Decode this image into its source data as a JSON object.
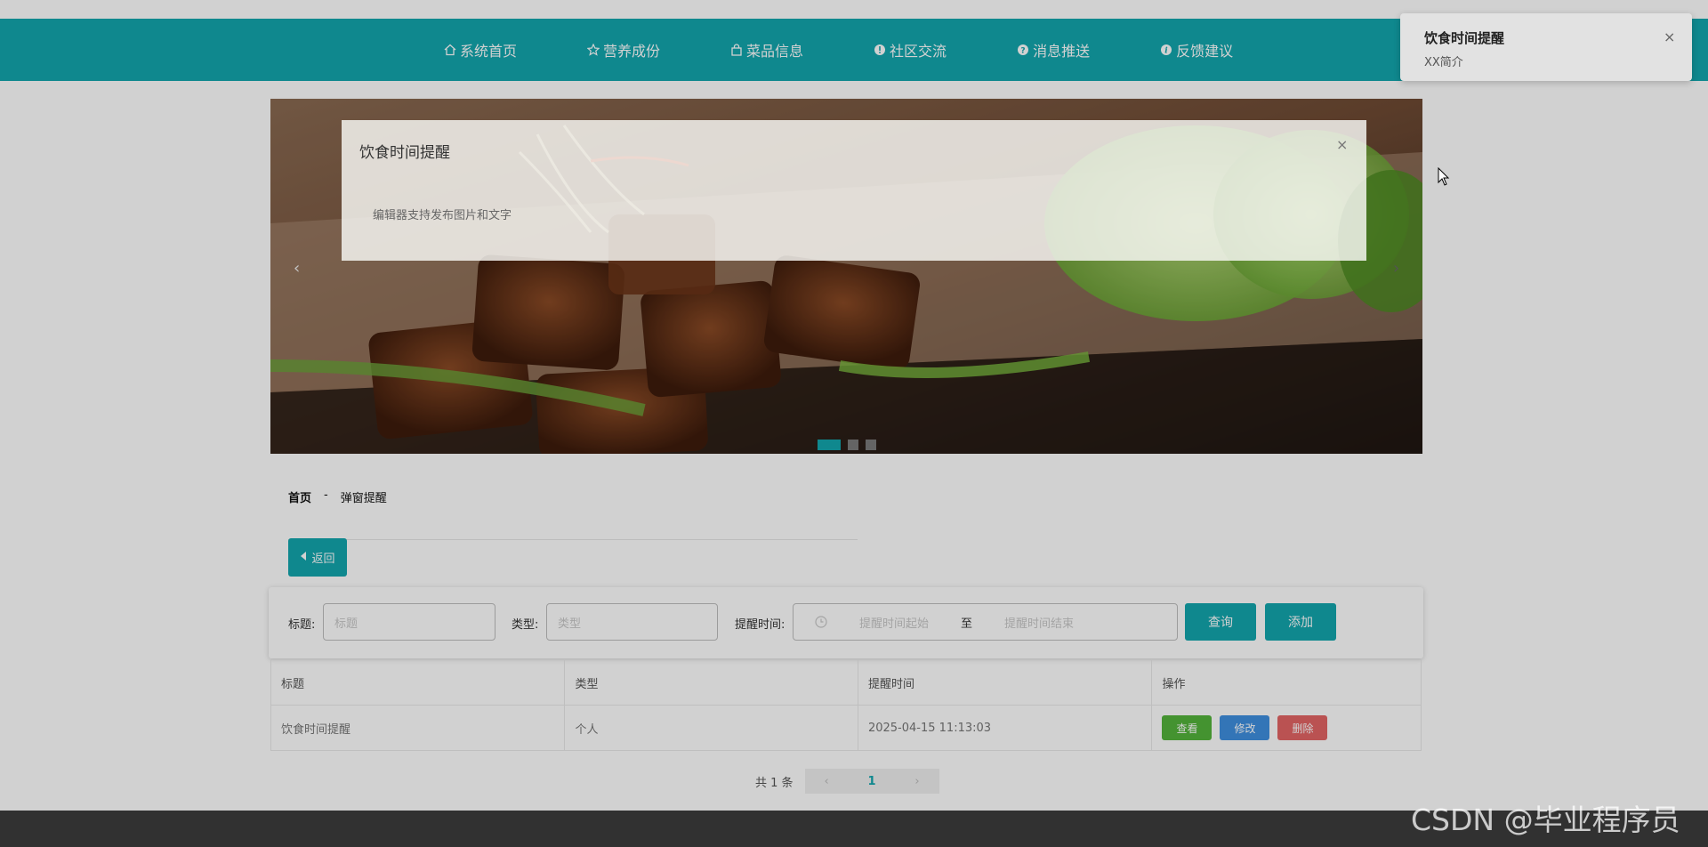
{
  "nav": {
    "items": [
      {
        "label": "系统首页",
        "icon": "home-icon"
      },
      {
        "label": "营养成份",
        "icon": "star-icon"
      },
      {
        "label": "菜品信息",
        "icon": "bag-icon"
      },
      {
        "label": "社区交流",
        "icon": "info-circle-icon"
      },
      {
        "label": "消息推送",
        "icon": "question-circle-icon"
      },
      {
        "label": "反馈建议",
        "icon": "info-circle-icon"
      }
    ]
  },
  "banner": {
    "prev_arrow": "‹",
    "next_arrow": "›",
    "slide_count": 3,
    "active_slide": 1
  },
  "breadcrumb": {
    "home": "首页",
    "separator": "-",
    "current": "弹窗提醒"
  },
  "back_button": {
    "label": "返回",
    "icon": "caret-left-icon"
  },
  "search": {
    "title_label": "标题:",
    "title_placeholder": "标题",
    "type_label": "类型:",
    "type_placeholder": "类型",
    "time_label": "提醒时间:",
    "time_start_placeholder": "提醒时间起始",
    "time_separator": "至",
    "time_end_placeholder": "提醒时间结束",
    "query_button": "查询",
    "add_button": "添加"
  },
  "table": {
    "headers": [
      "标题",
      "类型",
      "提醒时间",
      "操作"
    ],
    "rows": [
      {
        "title": "饮食时间提醒",
        "type": "个人",
        "time": "2025-04-15 11:13:03"
      }
    ],
    "actions": {
      "view": "查看",
      "edit": "修改",
      "delete": "删除"
    },
    "action_colors": {
      "view": "#53b43b",
      "edit": "#3f8fe0",
      "delete": "#e36565"
    }
  },
  "pagination": {
    "total": "共 1 条",
    "prev": "‹",
    "current": "1",
    "next": "›"
  },
  "modal": {
    "title": "饮食时间提醒",
    "body": "编辑器支持发布图片和文字",
    "close": "×"
  },
  "toast": {
    "title": "饮食时间提醒",
    "message": "XX简介",
    "close": "×"
  },
  "watermark": "CSDN @毕业程序员",
  "colors": {
    "accent": "#13a6ae",
    "footer": "#3c3c3c"
  }
}
